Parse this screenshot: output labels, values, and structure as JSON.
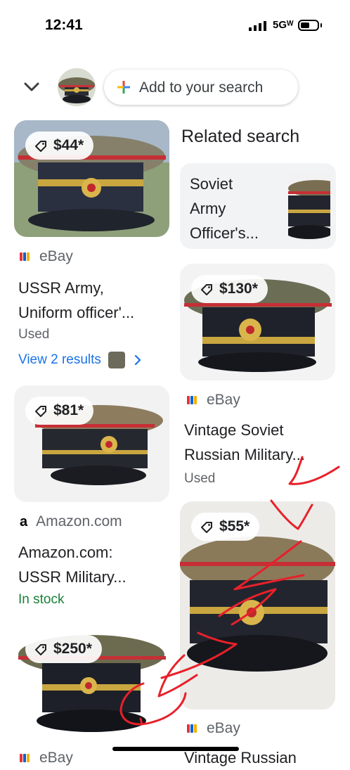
{
  "status": {
    "time": "12:41",
    "network": "5Gᵂ"
  },
  "search": {
    "add_label": "Add to your search"
  },
  "colors": {
    "link": "#1a73e8",
    "stock_green": "#188038",
    "annotation_red": "#e8202a"
  },
  "left_results": [
    {
      "price": "$44*",
      "source": "eBay",
      "title_line1": "USSR Army,",
      "title_line2": "Uniform officer'...",
      "condition": "Used",
      "link": "View 2 results"
    },
    {
      "price": "$81*",
      "source": "Amazon.com",
      "title_line1": "Amazon.com:",
      "title_line2": "USSR Military...",
      "stock": "In stock"
    },
    {
      "price": "$250*",
      "source": "eBay"
    }
  ],
  "related": {
    "heading": "Related search",
    "line1": "Soviet",
    "line2": "Army",
    "line3": "Officer's..."
  },
  "right_results": [
    {
      "price": "$130*",
      "source": "eBay",
      "title_line1": "Vintage Soviet",
      "title_line2": "Russian Military...",
      "condition": "Used"
    },
    {
      "price": "$55*",
      "source": "eBay",
      "title_line1": "Vintage Russian"
    }
  ]
}
